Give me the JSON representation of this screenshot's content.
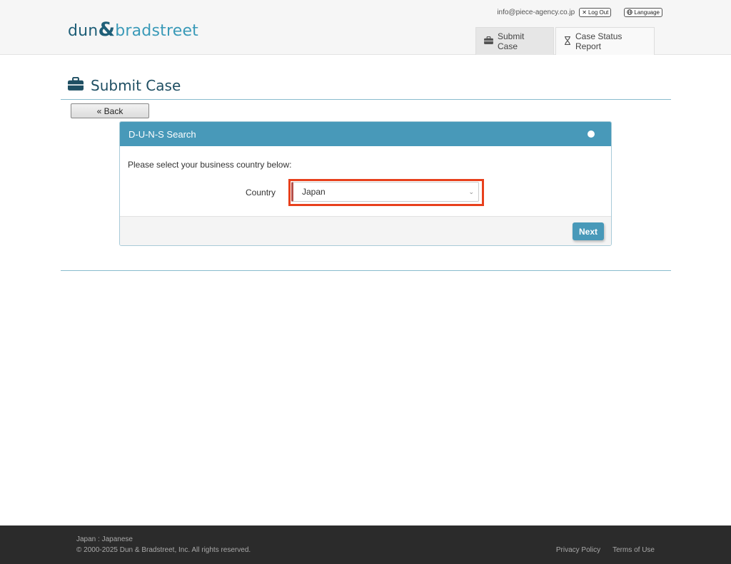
{
  "brand": {
    "part1": "dun",
    "amp": "&",
    "part2": "bradstreet"
  },
  "header": {
    "email": "info@piece-agency.co.jp",
    "logout_label": "Log Out",
    "language_label": "Language",
    "tabs": [
      {
        "label": "Submit Case",
        "icon": "briefcase-icon",
        "active": true
      },
      {
        "label": "Case Status Report",
        "icon": "hourglass-icon",
        "active": false
      }
    ]
  },
  "page": {
    "title": "Submit Case",
    "back_label": "« Back"
  },
  "panel": {
    "heading": "D-U-N-S Search",
    "prompt": "Please select your business country below:",
    "country_label": "Country",
    "country_value": "Japan",
    "next_label": "Next"
  },
  "footer": {
    "locale": "Japan : Japanese",
    "copyright": "© 2000-2025 Dun & Bradstreet, Inc. All rights reserved.",
    "privacy_label": "Privacy Policy",
    "terms_label": "Terms of Use"
  },
  "colors": {
    "accent": "#4899b9",
    "title": "#1f4f63",
    "highlight": "#e8401c",
    "footer_bg": "#2b2b2b"
  }
}
